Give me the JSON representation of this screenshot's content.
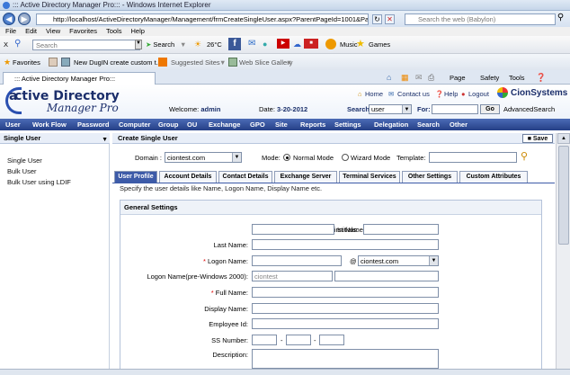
{
  "browser": {
    "window_title": "::: Active Directory Manager Pro::: - Windows Internet Explorer",
    "url": "http://localhost/ActiveDirectoryManager/Management/frmCreateSingleUser.aspx?ParentPageId=1001&PageGrou",
    "web_search_placeholder": "Search the web (Babylon)",
    "menu": [
      "File",
      "Edit",
      "View",
      "Favorites",
      "Tools",
      "Help"
    ],
    "toolbar": {
      "close": "X",
      "search_placeholder": "Search",
      "search_label": "Search",
      "weather": "26°C",
      "music": "Music",
      "games": "Games"
    },
    "favorites": {
      "label": "Favorites",
      "items": [
        "New DugIN create custom t...",
        "Suggested Sites",
        "Web Slice Gallery"
      ]
    },
    "tab_title": "::: Active Directory Manager Pro:::",
    "commands": [
      "Page",
      "Safety",
      "Tools"
    ]
  },
  "app": {
    "logo_line1": "ctive Directory",
    "logo_line2": "Manager Pro",
    "logo_initial": "a",
    "links": {
      "home": "Home",
      "contact": "Contact us",
      "help": "Help",
      "logout": "Logout"
    },
    "brand": "CionSystems",
    "welcome_label": "Welcome:",
    "welcome_user": "admin",
    "date_label": "Date:",
    "date_value": "3-20-2012",
    "search_label": "Search:",
    "search_scope": "user",
    "for_label": "For:",
    "go_label": "Go",
    "advanced_search": "AdvancedSearch",
    "nav": [
      "User",
      "Work Flow",
      "Password",
      "Computer",
      "Group",
      "OU",
      "Exchange",
      "GPO",
      "Site",
      "Reports",
      "Settings",
      "Delegation",
      "Search",
      "Other"
    ]
  },
  "left": {
    "header": "Single User",
    "items": [
      "Single User",
      "Bulk User",
      "Bulk User using LDIF"
    ]
  },
  "content": {
    "header": "Create Single User",
    "save_label": "Save",
    "domain_label": "Domain :",
    "domain_value": "ciontest.com",
    "mode_label": "Mode:",
    "mode_normal": "Normal Mode",
    "mode_wizard": "Wizard Mode",
    "mode_selected": "Normal Mode",
    "template_label": "Template:",
    "tabs": [
      "User Profile",
      "Account Details",
      "Contact Details",
      "Exchange Server",
      "Terminal Services",
      "Other Settings",
      "Custom Attributes"
    ],
    "active_tab": "User Profile",
    "description": "Specify the user details like Name, Logon Name, Display Name etc.",
    "section_title": "General Settings",
    "fields": {
      "first_name": "First Name:",
      "initials": "Initials:",
      "last_name": "Last Name:",
      "logon_name": "Logon Name:",
      "logon_at": "@",
      "logon_domain": "ciontest.com",
      "pre2000": "Logon Name(pre-Windows 2000):",
      "pre2000_domain": "ciontest",
      "full_name": "Full Name:",
      "display_name": "Display Name:",
      "employee_id": "Employee Id:",
      "ss_number": "SS Number:",
      "dash": "-",
      "description": "Description:",
      "required_mark": "*"
    }
  }
}
